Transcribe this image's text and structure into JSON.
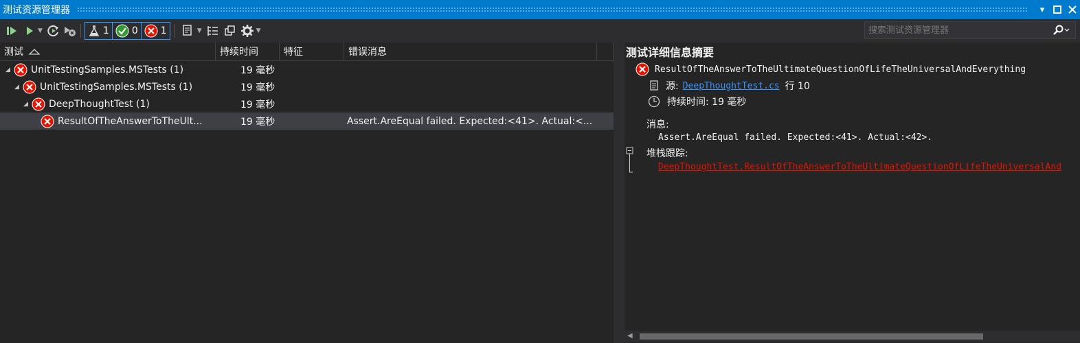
{
  "window": {
    "title": "测试资源管理器"
  },
  "toolbar": {
    "filters": [
      {
        "icon": "flask-icon",
        "count": "1"
      },
      {
        "icon": "passed-icon",
        "count": "0"
      },
      {
        "icon": "failed-icon",
        "count": "1"
      }
    ],
    "search_placeholder": "搜索测试资源管理器"
  },
  "columns": [
    "测试",
    "持续时间",
    "特征",
    "错误消息"
  ],
  "tree": [
    {
      "name": "UnitTestingSamples.MSTests (1)",
      "duration": "19 毫秒",
      "error": ""
    },
    {
      "name": "UnitTestingSamples.MSTests (1)",
      "duration": "19 毫秒",
      "error": ""
    },
    {
      "name": "DeepThoughtTest (1)",
      "duration": "19 毫秒",
      "error": ""
    },
    {
      "name": "ResultOfTheAnswerToTheUlt...",
      "duration": "19 毫秒",
      "error": "Assert.AreEqual failed. Expected:<41>. Actual:<..."
    }
  ],
  "detail": {
    "title": "测试详细信息摘要",
    "test_name": "ResultOfTheAnswerToTheUltimateQuestionOfLifeTheUniversalAndEverything",
    "source_label": "源:",
    "source_file": "DeepThoughtTest.cs",
    "line_label": "行 10",
    "duration_label": "持续时间: 19 毫秒",
    "message_label": "消息:",
    "message": "Assert.AreEqual failed. Expected:<41>. Actual:<42>.",
    "stack_label": "堆栈跟踪:",
    "stack_link": "DeepThoughtTest.ResultOfTheAnswerToTheUltimateQuestionOfLifeTheUniversalAnd"
  },
  "colors": {
    "accent": "#007acc",
    "error": "#e51400",
    "pass": "#339933",
    "link": "#3794ff"
  }
}
